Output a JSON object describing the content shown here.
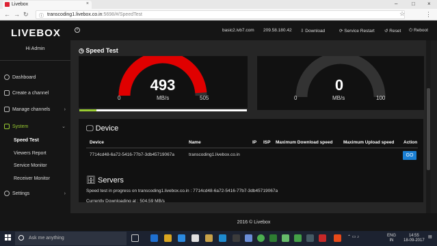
{
  "browser": {
    "tab_title": "Livebox",
    "tab_close": "×",
    "window_controls": [
      "–",
      "□",
      "×"
    ],
    "url_host": "transcoding1.livebox.co.in",
    "url_path": ":5698/#/SpeedTest"
  },
  "sidebar": {
    "logo": "LIVEBOX",
    "greeting": "Hi Admin",
    "items": [
      {
        "label": "Dashboard"
      },
      {
        "label": "Create a channel"
      },
      {
        "label": "Manage channels",
        "chevron": "›"
      },
      {
        "label": "System",
        "chevron": "⌄"
      },
      {
        "label": "Settings",
        "chevron": "›"
      }
    ],
    "sub_items": [
      {
        "label": "Speed Test"
      },
      {
        "label": "Viewers Report"
      },
      {
        "label": "Service Monitor"
      },
      {
        "label": "Receiver Monitor"
      }
    ]
  },
  "topbar": {
    "host": "basic2.ivb7.com",
    "ip": "209.58.180.42",
    "download": "Download",
    "service_restart": "Service Restart",
    "reset": "Reset",
    "reboot": "Reboot"
  },
  "speedtest": {
    "title": "Speed Test",
    "download_gauge": {
      "value": "493",
      "unit": "MB/s",
      "min": "0",
      "max": "505",
      "fraction": 0.976,
      "color": "#e00000"
    },
    "upload_gauge": {
      "value": "0",
      "unit": "MB/s",
      "min": "0",
      "max": "100",
      "fraction": 0,
      "color": "#e00000"
    },
    "progress_fraction": 0.1,
    "progress_color": "#9acd32"
  },
  "device": {
    "heading": "Device",
    "columns": [
      "Device",
      "Name",
      "IP",
      "ISP",
      "Maximum Download speed",
      "Maximum Upload speed",
      "Action"
    ],
    "row": {
      "device": "7714cd48-6a72-5416-77b7-3db45719067a",
      "name": "transcoding1.livebox.co.in",
      "action": "GO"
    }
  },
  "servers": {
    "heading": "Servers",
    "lines": [
      "Speed test in progress on transcoding1.livebox.co.in : 7714cd48-6a72-5416-77b7-3db45719067a",
      "Currently Downloading at : 504.59 MB/s"
    ]
  },
  "footer": "2016 © Livebox",
  "taskbar": {
    "search_placeholder": "Ask me anything",
    "lang": "ENG",
    "region": "IN",
    "time": "14:55",
    "date": "18-09-2017"
  }
}
